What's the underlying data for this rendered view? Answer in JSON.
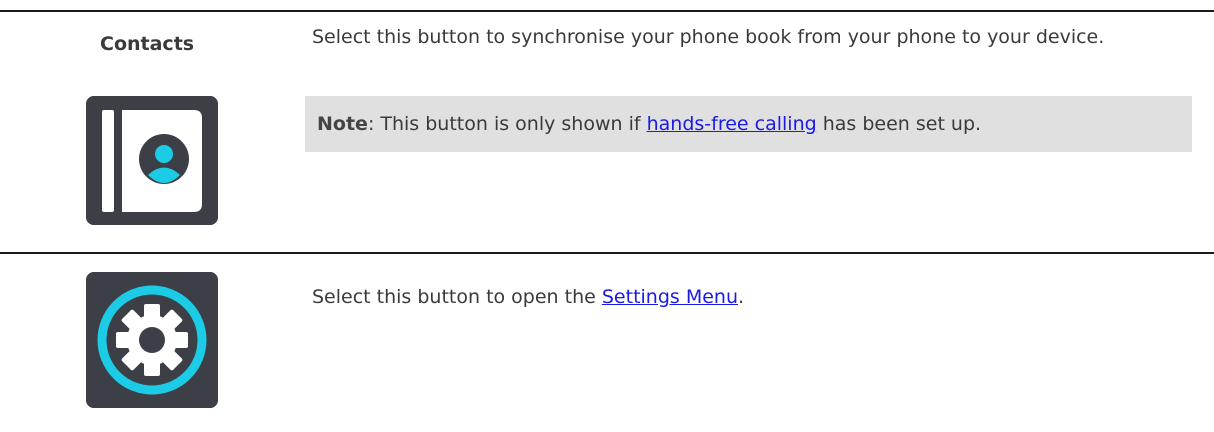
{
  "contacts_row": {
    "label": "Contacts",
    "description": "Select this button to synchronise your phone book from your phone to your device.",
    "note": {
      "prefix": "Note",
      "text_before": ": This button is only shown if ",
      "link": "hands-free calling",
      "text_after": " has been set up."
    },
    "icon": "contacts-book-icon"
  },
  "settings_row": {
    "description_before": "Select this button to open the ",
    "link": "Settings Menu",
    "description_after": ".",
    "icon": "settings-gear-icon"
  },
  "colors": {
    "icon_background": "#3c3f46",
    "icon_accent": "#1ccbe6",
    "note_background": "#e0e0e0",
    "link": "#1a1ae6"
  }
}
